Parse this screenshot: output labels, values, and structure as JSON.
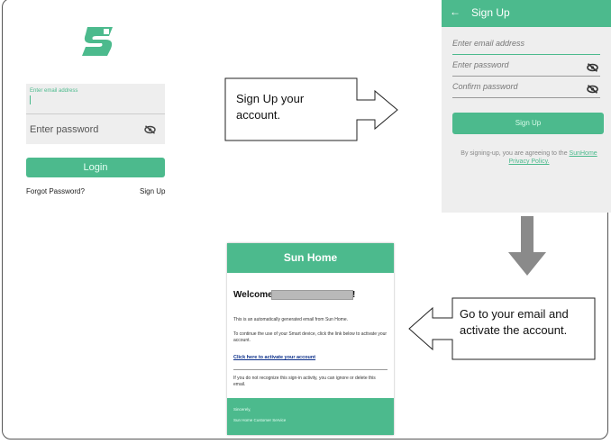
{
  "login": {
    "email_placeholder": "Enter email address",
    "password_placeholder": "Enter password",
    "login_button": "Login",
    "forgot_password": "Forgot Password?",
    "sign_up_link": "Sign Up"
  },
  "callouts": {
    "sign_up_line1": "Sign Up your",
    "sign_up_line2": "account.",
    "email_line1": "Go to your email and",
    "email_line2": "activate the account."
  },
  "signup": {
    "back_icon": "arrow-left-icon",
    "title": "Sign Up",
    "email_placeholder": "Enter email address",
    "password_placeholder": "Enter password",
    "confirm_placeholder": "Confirm password",
    "button": "Sign Up",
    "terms_prefix": "By signing-up, you are agreeing to the ",
    "terms_link_1": "SunHome",
    "terms_link_2": "Privacy Policy."
  },
  "email": {
    "brand": "Sun Home",
    "welcome": "Welcome",
    "exclaim": "!",
    "para1": "This is an automatically generated email from Sun Home.",
    "para2": "To continue the use of your Smart device, click the link below to activate your account.",
    "link": "Click here to activate your account",
    "para3": "If you do not recognize this sign-in activity, you can ignore or delete this email.",
    "footer_1": "Sincerely,",
    "footer_2": "Sun Home Customer Service"
  },
  "colors": {
    "accent": "#4cba8d",
    "field_bg": "#eeeeee"
  }
}
